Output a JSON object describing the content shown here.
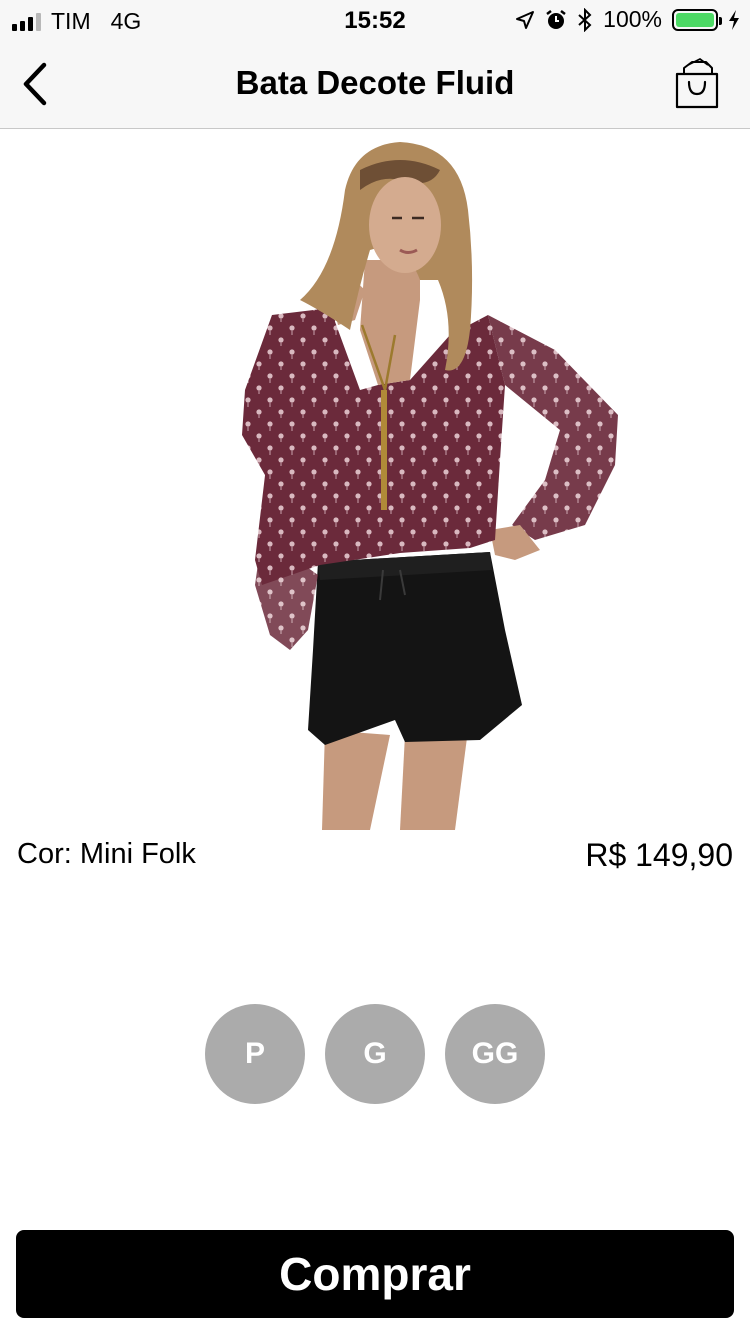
{
  "status_bar": {
    "carrier": "TIM",
    "network": "4G",
    "time": "15:52",
    "battery": "100%",
    "icons": [
      "signal-icon",
      "location-icon",
      "alarm-icon",
      "bluetooth-icon",
      "battery-icon",
      "charging-icon"
    ],
    "battery_color": "#4cd964"
  },
  "nav": {
    "title": "Bata Decote Fluid",
    "back_icon": "chevron-left-icon",
    "bag_icon": "shopping-bag-icon"
  },
  "product": {
    "color_label": "Cor: Mini Folk",
    "price": "R$ 149,90",
    "blouse_color": "#6b2a3b"
  },
  "sizes": [
    "P",
    "G",
    "GG"
  ],
  "buy_label": "Comprar"
}
